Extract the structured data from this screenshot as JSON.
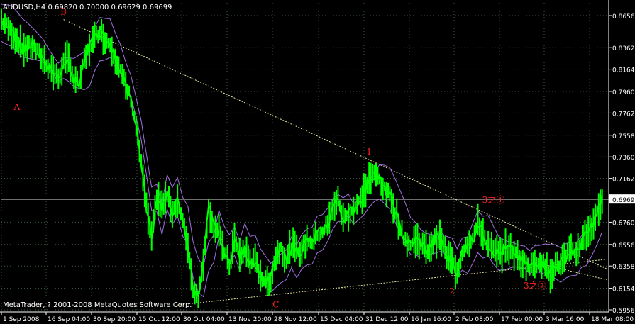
{
  "chart_data": {
    "type": "candlestick",
    "symbol_info": "AUDUSD,H4  0.69820 0.70000 0.69629 0.69699",
    "current_price": "0.69699",
    "watermark": "MetaTrader, ? 2001-2008 MetaQuotes Software Corp.",
    "y_ticks": [
      "0.86560",
      "0.83620",
      "0.81640",
      "0.79600",
      "0.77620",
      "0.75580",
      "0.73600",
      "0.71620",
      "0.69699",
      "0.67600",
      "0.65560",
      "0.63580",
      "0.61540",
      "0.59560"
    ],
    "y_tick_values": [
      0.8656,
      0.8362,
      0.8164,
      0.796,
      0.7762,
      0.7558,
      0.736,
      0.7162,
      0.69699,
      0.676,
      0.6556,
      0.6358,
      0.6154,
      0.5956
    ],
    "x_ticks": [
      "1 Sep 2008",
      "16 Sep 04:00",
      "30 Sep 20:00",
      "15 Oct 12:00",
      "30 Oct 04:00",
      "13 Nov 20:00",
      "28 Nov 12:00",
      "15 Dec 04:00",
      "31 Dec 12:00",
      "16 Jan 16:00",
      "2 Feb 08:00",
      "17 Feb 00:00",
      "3 Mar 16:00",
      "18 Mar 08:00"
    ],
    "ylim": [
      0.5956,
      0.8656
    ],
    "price_path": [
      [
        0,
        0.862
      ],
      [
        2,
        0.85
      ],
      [
        4,
        0.836
      ],
      [
        6,
        0.838
      ],
      [
        8,
        0.826
      ],
      [
        10,
        0.814
      ],
      [
        11,
        0.808
      ],
      [
        12,
        0.822
      ],
      [
        13,
        0.826
      ],
      [
        14,
        0.806
      ],
      [
        15,
        0.803
      ],
      [
        16,
        0.824
      ],
      [
        17,
        0.836
      ],
      [
        18,
        0.845
      ],
      [
        19,
        0.852
      ],
      [
        20,
        0.844
      ],
      [
        21,
        0.84
      ],
      [
        22,
        0.827
      ],
      [
        23,
        0.815
      ],
      [
        24,
        0.8
      ],
      [
        25,
        0.79
      ],
      [
        26,
        0.765
      ],
      [
        27,
        0.73
      ],
      [
        28,
        0.69
      ],
      [
        29,
        0.66
      ],
      [
        30,
        0.7
      ],
      [
        31,
        0.69
      ],
      [
        32,
        0.7
      ],
      [
        33,
        0.686
      ],
      [
        34,
        0.695
      ],
      [
        35,
        0.676
      ],
      [
        36,
        0.655
      ],
      [
        37,
        0.614
      ],
      [
        38,
        0.609
      ],
      [
        39,
        0.64
      ],
      [
        40,
        0.69
      ],
      [
        41,
        0.672
      ],
      [
        42,
        0.665
      ],
      [
        43,
        0.65
      ],
      [
        44,
        0.636
      ],
      [
        45,
        0.66
      ],
      [
        46,
        0.645
      ],
      [
        47,
        0.65
      ],
      [
        48,
        0.641
      ],
      [
        49,
        0.64
      ],
      [
        50,
        0.628
      ],
      [
        51,
        0.62
      ],
      [
        52,
        0.624
      ],
      [
        53,
        0.645
      ],
      [
        54,
        0.653
      ],
      [
        55,
        0.64
      ],
      [
        56,
        0.655
      ],
      [
        57,
        0.65
      ],
      [
        58,
        0.65
      ],
      [
        59,
        0.66
      ],
      [
        60,
        0.658
      ],
      [
        61,
        0.665
      ],
      [
        62,
        0.668
      ],
      [
        63,
        0.673
      ],
      [
        64,
        0.69
      ],
      [
        65,
        0.697
      ],
      [
        66,
        0.679
      ],
      [
        67,
        0.684
      ],
      [
        68,
        0.688
      ],
      [
        69,
        0.694
      ],
      [
        70,
        0.703
      ],
      [
        71,
        0.715
      ],
      [
        72,
        0.72
      ],
      [
        73,
        0.716
      ],
      [
        74,
        0.705
      ],
      [
        75,
        0.7
      ],
      [
        76,
        0.688
      ],
      [
        77,
        0.67
      ],
      [
        78,
        0.66
      ],
      [
        79,
        0.655
      ],
      [
        80,
        0.66
      ],
      [
        81,
        0.657
      ],
      [
        82,
        0.65
      ],
      [
        83,
        0.655
      ],
      [
        84,
        0.662
      ],
      [
        85,
        0.66
      ],
      [
        86,
        0.645
      ],
      [
        87,
        0.64
      ],
      [
        88,
        0.63
      ],
      [
        89,
        0.65
      ],
      [
        90,
        0.658
      ],
      [
        91,
        0.66
      ],
      [
        92,
        0.675
      ],
      [
        93,
        0.665
      ],
      [
        94,
        0.655
      ],
      [
        95,
        0.65
      ],
      [
        96,
        0.647
      ],
      [
        97,
        0.65
      ],
      [
        98,
        0.652
      ],
      [
        99,
        0.648
      ],
      [
        100,
        0.641
      ],
      [
        101,
        0.64
      ],
      [
        102,
        0.634
      ],
      [
        103,
        0.639
      ],
      [
        104,
        0.641
      ],
      [
        105,
        0.635
      ],
      [
        106,
        0.63
      ],
      [
        107,
        0.636
      ],
      [
        108,
        0.638
      ],
      [
        109,
        0.644
      ],
      [
        110,
        0.65
      ],
      [
        111,
        0.648
      ],
      [
        112,
        0.658
      ],
      [
        113,
        0.665
      ],
      [
        114,
        0.672
      ],
      [
        115,
        0.684
      ],
      [
        116,
        0.697
      ]
    ],
    "wave_labels": [
      {
        "text": "B",
        "x": 12,
        "y": 0.8665
      },
      {
        "text": "A",
        "x": 3,
        "y": 0.779
      },
      {
        "text": "1",
        "x": 71,
        "y": 0.738
      },
      {
        "text": "C",
        "x": 53,
        "y": 0.598
      },
      {
        "text": "2",
        "x": 87,
        "y": 0.61
      },
      {
        "text": "3之①",
        "x": 95,
        "y": 0.694
      },
      {
        "text": "3之②",
        "x": 103,
        "y": 0.615
      }
    ],
    "trendlines": [
      {
        "name": "upper",
        "from": [
          12,
          0.862
        ],
        "to": [
          117,
          0.633
        ]
      },
      {
        "name": "lower",
        "from": [
          34,
          0.6
        ],
        "to": [
          117,
          0.642
        ]
      },
      {
        "name": "lower2",
        "from": [
          104,
          0.638
        ],
        "to": [
          117,
          0.623
        ]
      }
    ],
    "colors": {
      "background": "#000000",
      "price": "#00ff00",
      "envelope": "#a070e0",
      "grid": "#3b5b3b",
      "axis_text": "#ffffff",
      "label": "#ff2020",
      "trendline": "#e8e8a0",
      "current_line": "#b0b0b0"
    },
    "grid": true,
    "legend": "top-left"
  }
}
